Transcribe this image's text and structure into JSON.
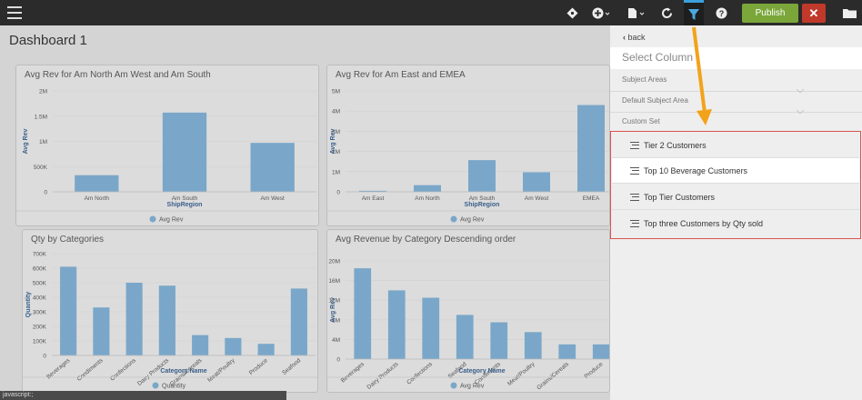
{
  "topbar": {
    "publish_label": "Publish",
    "close_label": "✕",
    "icons": [
      "hamburger-icon",
      "tag-icon",
      "plus-circle-icon",
      "document-icon",
      "refresh-icon",
      "filter-icon",
      "help-icon",
      "folder-icon"
    ]
  },
  "dashboard": {
    "title": "Dashboard 1"
  },
  "charts": {
    "c1": {
      "title": "Avg Rev for Am North Am West and Am South"
    },
    "c2": {
      "title": "Avg Rev for Am East and EMEA"
    },
    "c3": {
      "title": "Qty by Categories"
    },
    "c4": {
      "title": "Avg Revenue by Category Descending order"
    }
  },
  "chart_data": [
    {
      "type": "bar",
      "title": "Avg Rev for Am North Am West and Am South",
      "xlabel": "ShipRegion",
      "ylabel": "Avg Rev",
      "categories": [
        "Am North",
        "Am South",
        "Am West"
      ],
      "values": [
        330000,
        1570000,
        970000
      ],
      "yticks": [
        "0",
        "500K",
        "1M",
        "1.5M",
        "2M"
      ],
      "ylim": [
        0,
        2000000
      ],
      "legend": "Avg Rev",
      "color": "#7aa7c9"
    },
    {
      "type": "bar",
      "title": "Avg Rev for Am East and EMEA",
      "xlabel": "ShipRegion",
      "ylabel": "Avg Rev",
      "categories": [
        "Am East",
        "Am North",
        "Am South",
        "Am West",
        "EMEA"
      ],
      "values": [
        50000,
        330000,
        1570000,
        970000,
        4300000
      ],
      "yticks": [
        "0",
        "1M",
        "2M",
        "3M",
        "4M",
        "5M"
      ],
      "ylim": [
        0,
        5000000
      ],
      "legend": "Avg Rev",
      "color": "#7aa7c9"
    },
    {
      "type": "bar",
      "title": "Qty by Categories",
      "xlabel": "Category Name",
      "ylabel": "Quantity",
      "categories": [
        "Beverages",
        "Condiments",
        "Confections",
        "Dairy Products",
        "Grains/Cereals",
        "Meat/Poultry",
        "Produce",
        "Seafood"
      ],
      "values": [
        610000,
        330000,
        500000,
        480000,
        140000,
        120000,
        80000,
        460000
      ],
      "yticks": [
        "0",
        "100K",
        "200K",
        "300K",
        "400K",
        "500K",
        "600K",
        "700K"
      ],
      "ylim": [
        0,
        700000
      ],
      "legend": "Quantity",
      "color": "#7aa7c9"
    },
    {
      "type": "bar",
      "title": "Avg Revenue by Category Descending order",
      "xlabel": "Category Name",
      "ylabel": "Avg Rev",
      "categories": [
        "Beverages",
        "Dairy Products",
        "Confections",
        "Seafood",
        "Condiments",
        "Meat/Poultry",
        "Grains/Cereals",
        "Produce"
      ],
      "values": [
        18500000,
        14000000,
        12500000,
        9000000,
        7500000,
        5500000,
        3000000,
        3000000
      ],
      "yticks": [
        "0",
        "4M",
        "8M",
        "12M",
        "16M",
        "20M"
      ],
      "ylim": [
        0,
        20000000
      ],
      "legend": "Avg Rev",
      "color": "#7aa7c9"
    }
  ],
  "sidepanel": {
    "back_label": "back",
    "select_column": "Select Column",
    "sections": [
      "Subject Areas",
      "Default Subject Area",
      "Custom Set"
    ],
    "custom_items": [
      "Tier 2 Customers",
      "Top 10 Beverage Customers",
      "Top Tier Customers",
      "Top three Customers by Qty sold"
    ]
  },
  "status": {
    "text": "javascript:;"
  }
}
